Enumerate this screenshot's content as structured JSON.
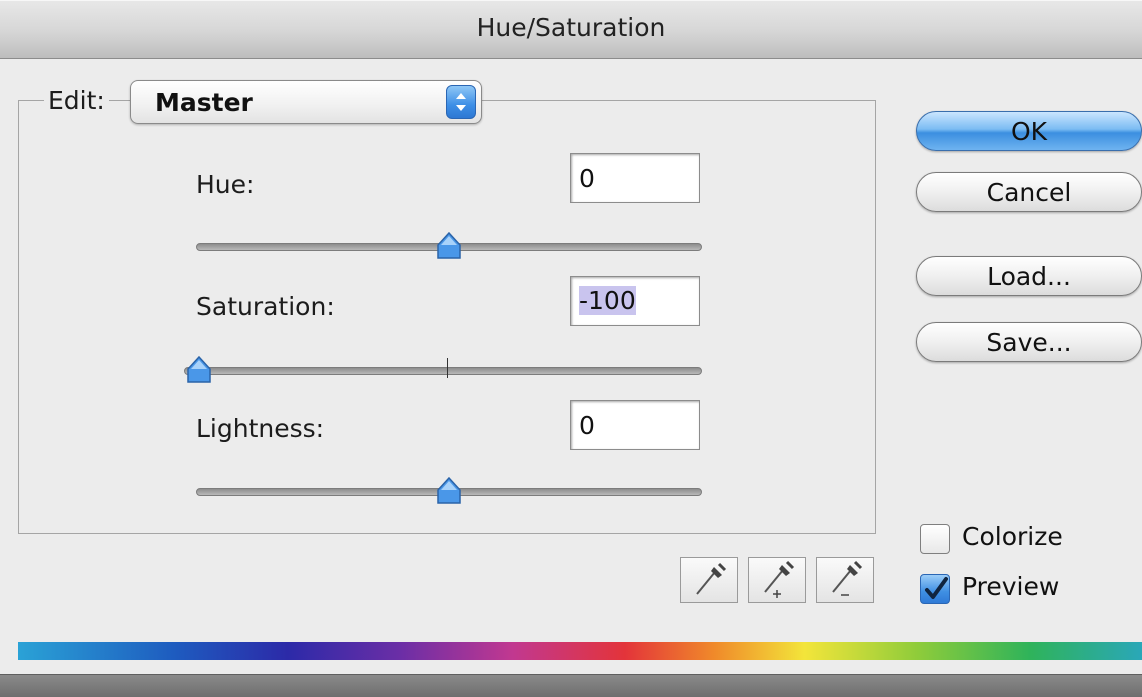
{
  "window": {
    "title": "Hue/Saturation"
  },
  "edit": {
    "label": "Edit:",
    "selected": "Master"
  },
  "fields": {
    "hue": {
      "label": "Hue:",
      "value": "0",
      "slider_fraction": 0.5
    },
    "saturation": {
      "label": "Saturation:",
      "value": "-100",
      "slider_fraction": 0.0
    },
    "lightness": {
      "label": "Lightness:",
      "value": "0",
      "slider_fraction": 0.5
    }
  },
  "buttons": {
    "ok": "OK",
    "cancel": "Cancel",
    "load": "Load...",
    "save": "Save..."
  },
  "options": {
    "colorize": {
      "label": "Colorize",
      "checked": false
    },
    "preview": {
      "label": "Preview",
      "checked": true
    }
  },
  "eyedroppers": [
    "eyedropper-icon",
    "eyedropper-add-icon",
    "eyedropper-subtract-icon"
  ],
  "colors": {
    "accent": "#3b8fe0",
    "selection_highlight": "#c9c4ee",
    "thumb": "#4a97e8"
  }
}
